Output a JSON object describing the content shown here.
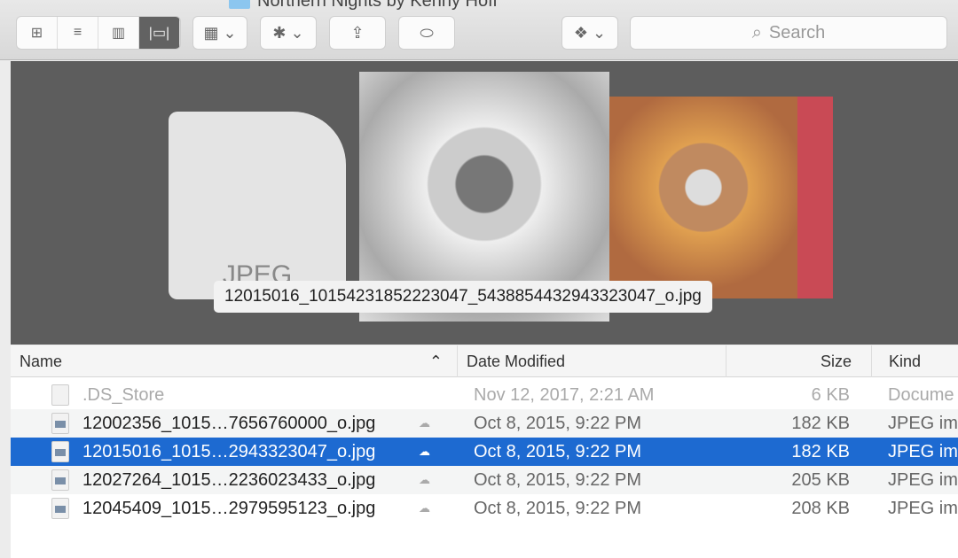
{
  "window": {
    "title": "Northern Nights by Kenny Hoff"
  },
  "toolbar": {
    "view_icons": "⊞",
    "view_list": "≡",
    "view_columns": "▥",
    "view_coverflow": "|▭|",
    "arrange": "▦ ⌄",
    "action": "✱ ⌄",
    "share": "⇪",
    "tags": "⬭",
    "dropbox": "❖ ⌄",
    "search_icon": "⌕",
    "search_placeholder": "Search"
  },
  "coverflow": {
    "doc_label": "JPEG",
    "caption": "12015016_10154231852223047_5438854432943323047_o.jpg"
  },
  "columns": {
    "name": "Name",
    "sort": "⌃",
    "date": "Date Modified",
    "size": "Size",
    "kind": "Kind"
  },
  "files": [
    {
      "name": ".DS_Store",
      "date": "Nov 12, 2017, 2:21 AM",
      "size": "6 KB",
      "kind": "Docume",
      "cloud": ""
    },
    {
      "name": "12002356_1015…7656760000_o.jpg",
      "date": "Oct 8, 2015, 9:22 PM",
      "size": "182 KB",
      "kind": "JPEG im",
      "cloud": "☁"
    },
    {
      "name": "12015016_1015…2943323047_o.jpg",
      "date": "Oct 8, 2015, 9:22 PM",
      "size": "182 KB",
      "kind": "JPEG im",
      "cloud": "☁"
    },
    {
      "name": "12027264_1015…2236023433_o.jpg",
      "date": "Oct 8, 2015, 9:22 PM",
      "size": "205 KB",
      "kind": "JPEG im",
      "cloud": "☁"
    },
    {
      "name": "12045409_1015…2979595123_o.jpg",
      "date": "Oct 8, 2015, 9:22 PM",
      "size": "208 KB",
      "kind": "JPEG im",
      "cloud": "☁"
    }
  ]
}
